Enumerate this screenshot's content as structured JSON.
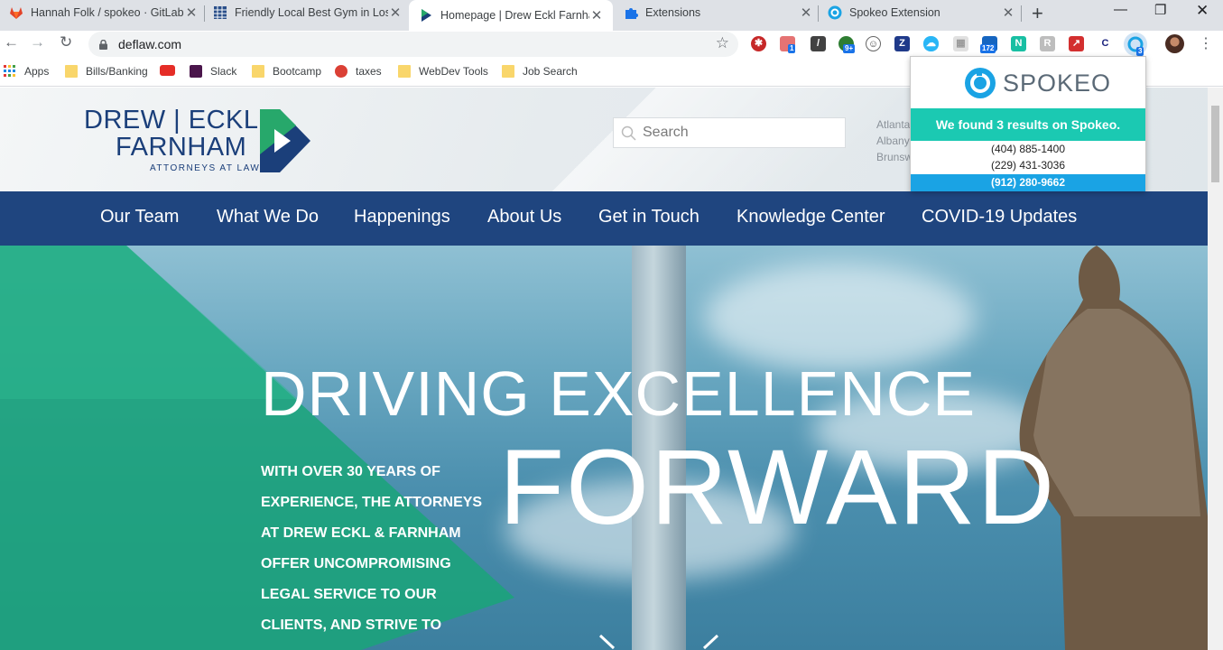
{
  "browser": {
    "tabs": [
      {
        "title": "Hannah Folk / spokeo · GitLab",
        "favicon": "gitlab-icon",
        "active": false
      },
      {
        "title": "Friendly Local Best Gym in Los",
        "favicon": "spreadsheet-icon",
        "active": false
      },
      {
        "title": "Homepage | Drew Eckl Farnhar",
        "favicon": "drew-eckl-icon",
        "active": true
      },
      {
        "title": "Extensions",
        "favicon": "puzzle-icon",
        "active": false
      },
      {
        "title": "Spokeo Extension",
        "favicon": "spokeo-icon",
        "active": false
      }
    ],
    "url": "deflaw.com",
    "extension_badges": {
      "puzzle": "1",
      "green": "9+",
      "calendar": "172",
      "spokeo": "3"
    },
    "bookmarks": [
      {
        "label": "Apps",
        "icon": "apps-grid-icon"
      },
      {
        "label": "Bills/Banking",
        "icon": "folder-icon"
      },
      {
        "label": "",
        "icon": "youtube-icon"
      },
      {
        "label": "Slack",
        "icon": "slack-icon"
      },
      {
        "label": "Bootcamp",
        "icon": "folder-icon"
      },
      {
        "label": "taxes",
        "icon": "todoist-icon"
      },
      {
        "label": "WebDev Tools",
        "icon": "folder-icon"
      },
      {
        "label": "Job Search",
        "icon": "folder-icon"
      }
    ]
  },
  "site": {
    "logo": {
      "line1": "DREW | ECKL",
      "line2": "FARNHAM",
      "tagline": "ATTORNEYS AT LAW"
    },
    "search_placeholder": "Search",
    "cities": [
      "Atlanta",
      "Albany",
      "Brunsw"
    ],
    "nav": [
      "Our Team",
      "What We Do",
      "Happenings",
      "About Us",
      "Get in Touch",
      "Knowledge Center",
      "COVID-19 Updates"
    ],
    "hero": {
      "title": "DRIVING EXCELLENCE",
      "title2": "FORWARD",
      "body": "WITH OVER 30 YEARS OF EXPERIENCE, THE ATTORNEYS AT DREW ECKL & FARNHAM OFFER UNCOMPROMISING LEGAL SERVICE TO OUR CLIENTS, AND STRIVE TO IMPLEMENT"
    }
  },
  "spokeo_popup": {
    "brand": "SPOKEO",
    "found_text": "We found 3 results on Spokeo.",
    "phones": [
      "(404) 885-1400",
      "(229) 431-3036",
      "(912) 280-9662"
    ]
  },
  "colors": {
    "nav_blue": "#163d7a",
    "teal": "#1bc9b2",
    "spokeo_blue": "#1aa3e4",
    "logo_green": "#27a86b"
  }
}
